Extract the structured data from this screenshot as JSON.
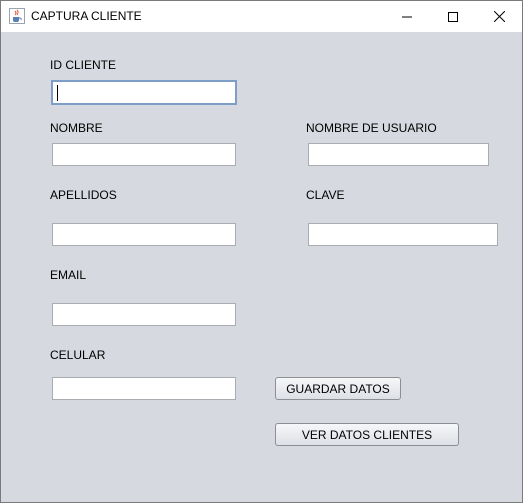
{
  "window": {
    "title": "CAPTURA CLIENTE",
    "icon": "java-cup-icon"
  },
  "form": {
    "id_cliente": {
      "label": "ID CLIENTE",
      "value": ""
    },
    "nombre": {
      "label": "NOMBRE",
      "value": ""
    },
    "nombre_usuario": {
      "label": "NOMBRE DE USUARIO",
      "value": ""
    },
    "apellidos": {
      "label": "APELLIDOS",
      "value": ""
    },
    "clave": {
      "label": "CLAVE",
      "value": ""
    },
    "email": {
      "label": "EMAIL",
      "value": ""
    },
    "celular": {
      "label": "CELULAR",
      "value": ""
    }
  },
  "buttons": {
    "guardar": "GUARDAR DATOS",
    "ver": "VER DATOS CLIENTES"
  },
  "colors": {
    "background": "#d6d9e0",
    "focus_border": "#7d9fc7"
  }
}
